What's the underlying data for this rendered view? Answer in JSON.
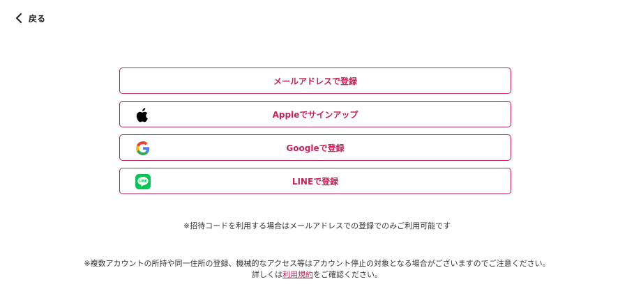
{
  "header": {
    "back_label": "戻る",
    "back_icon": "chevron-left-icon"
  },
  "signup_buttons": {
    "email_label": "メールアドレスで登録",
    "apple_label": "Appleでサインアップ",
    "apple_icon": "apple-logo-icon",
    "google_label": "Googleで登録",
    "google_icon": "google-logo-icon",
    "line_label": "LINEで登録",
    "line_icon": "line-logo-icon",
    "line_logo_text": "LINE"
  },
  "notes": {
    "invite_code": "※招待コードを利用する場合はメールアドレスでの登録でのみご利用可能です",
    "warning": "※複数アカウントの所持や同一住所の登録、機械的なアクセス等はアカウント停止の対象となる場合がございますのでご注意ください。",
    "terms_prefix": "詳しくは",
    "terms_link": "利用規約",
    "terms_suffix": "をご確認ください。"
  },
  "colors": {
    "accent": "#c22456",
    "border": "#b2205a",
    "line_green": "#06c755",
    "text": "#333333"
  }
}
